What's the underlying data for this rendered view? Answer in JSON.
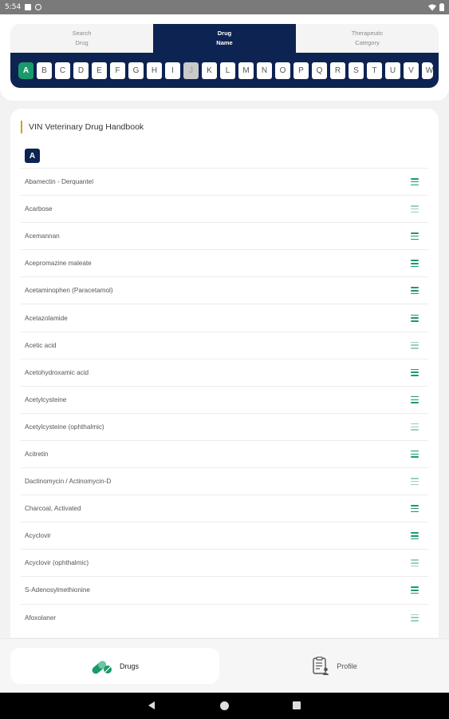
{
  "status_bar": {
    "time": "5:54",
    "icons": [
      "sim-card-icon",
      "at-sign-icon",
      "wifi-icon",
      "battery-icon"
    ]
  },
  "tabs": [
    {
      "line1": "Search",
      "line2": "Drug",
      "active": false
    },
    {
      "line1": "Drug",
      "line2": "Name",
      "active": true
    },
    {
      "line1": "Therapeutic",
      "line2": "Category",
      "active": false
    }
  ],
  "alphabet": {
    "letters": [
      "A",
      "B",
      "C",
      "D",
      "E",
      "F",
      "G",
      "H",
      "I",
      "J",
      "K",
      "L",
      "M",
      "N",
      "O",
      "P",
      "Q",
      "R",
      "S",
      "T",
      "U",
      "V",
      "W"
    ],
    "active": "A",
    "disabled": [
      "J"
    ]
  },
  "list": {
    "title": "VIN Veterinary Drug Handbook",
    "section": "A",
    "items": [
      "Abamectin - Derquantel",
      "Acarbose",
      "Acemannan",
      "Acepromazine maleate",
      "Acetaminophen (Paracetamol)",
      "Acetazolamide",
      "Acetic acid",
      "Acetohydroxamic acid",
      "Acetylcysteine",
      "Acetylcysteine (ophthalmic)",
      "Acitretin",
      "Dactinomycin / Actinomycin-D",
      "Charcoal, Activated",
      "Acyclovir",
      "Acyclovir (ophthalmic)",
      "S-Adenosylmethionine",
      "Afoxolaner"
    ],
    "faded_icons": [
      1,
      6,
      9,
      11,
      14,
      16
    ]
  },
  "bottom_nav": {
    "drugs_label": "Drugs",
    "profile_label": "Profile"
  },
  "colors": {
    "navy": "#0d2352",
    "accent_green": "#1a9a6c",
    "title_bar": "#d4a017"
  }
}
